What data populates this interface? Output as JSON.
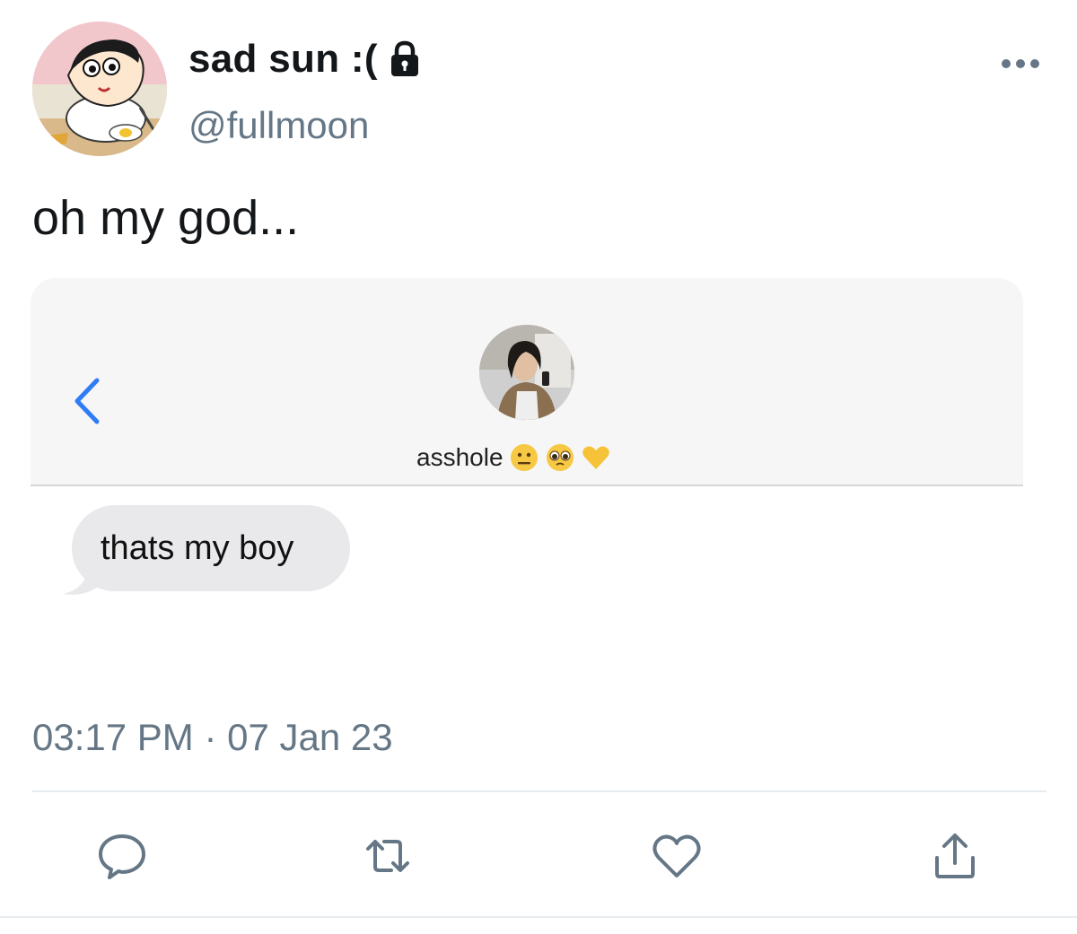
{
  "tweet": {
    "display_name": "sad sun :(",
    "handle": "@fullmoon",
    "text": "oh my god...",
    "timestamp": "03:17 PM · 07 Jan 23",
    "protected_icon": "lock-icon",
    "more_icon": "more-horizontal-icon"
  },
  "media": {
    "contact_name": "asshole",
    "contact_emojis": [
      "neutral-face-emoji",
      "pleading-face-emoji",
      "yellow-heart-emoji"
    ],
    "message": "thats my boy",
    "back_icon": "chevron-left-icon"
  },
  "actions": [
    {
      "name": "reply",
      "icon": "speech-bubble-icon"
    },
    {
      "name": "retweet",
      "icon": "retweet-icon"
    },
    {
      "name": "like",
      "icon": "heart-icon"
    },
    {
      "name": "share",
      "icon": "share-icon"
    }
  ],
  "colors": {
    "text": "#14171a",
    "secondary": "#657786",
    "ios_blue": "#2f7cf6",
    "bubble": "#e9e9eb",
    "divider": "#e6ecf0"
  }
}
